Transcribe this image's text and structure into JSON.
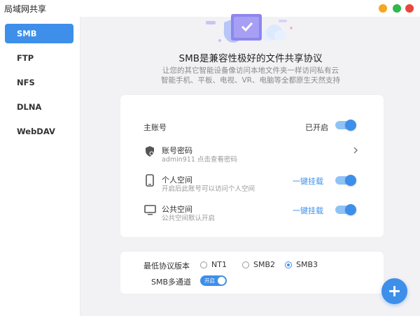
{
  "window": {
    "title": "局域网共享"
  },
  "sidebar": {
    "items": [
      {
        "label": "SMB",
        "active": true
      },
      {
        "label": "FTP"
      },
      {
        "label": "NFS"
      },
      {
        "label": "DLNA"
      },
      {
        "label": "WebDAV"
      }
    ]
  },
  "header": {
    "title": "SMB是兼容性极好的文件共享协议",
    "subtitle_line1": "让您的其它智能设备像访问本地文件夹一样访问私有云",
    "subtitle_line2": "智能手机、平板、电视、VR、电脑等全都原生天然支持"
  },
  "main_account": {
    "label": "主账号",
    "status": "已开启",
    "enabled": true
  },
  "password_row": {
    "title": "账号密码",
    "subtitle": "admin911 点击查看密码",
    "icon": "shield-icon"
  },
  "personal_space": {
    "title": "个人空间",
    "subtitle": "开启后此账号可以访问个人空间",
    "action": "一键挂载",
    "enabled": true,
    "icon": "phone-icon"
  },
  "public_space": {
    "title": "公共空间",
    "subtitle": "公共空间默认开启",
    "action": "一键挂载",
    "enabled": true,
    "icon": "monitor-icon"
  },
  "protocol": {
    "label": "最低协议版本",
    "options": [
      "NT1",
      "SMB2",
      "SMB3"
    ],
    "selected": "SMB3"
  },
  "multichannel": {
    "label": "SMB多通道",
    "toggle_text": "开启",
    "enabled": true
  },
  "colors": {
    "accent": "#3d8fea",
    "background": "#f2f2f4"
  }
}
